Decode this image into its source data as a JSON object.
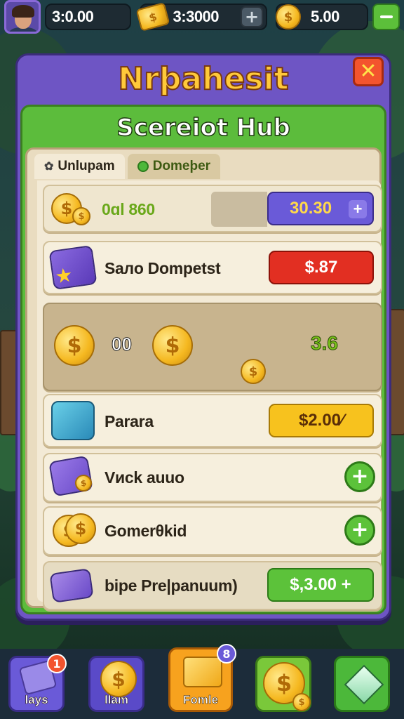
{
  "topbar": {
    "res1": {
      "value": "3:0.00"
    },
    "res2": {
      "value": "3:3000"
    },
    "res3": {
      "value": "5.00"
    }
  },
  "panel": {
    "title": "Nrþahesit",
    "subtitle": "Scereiot Hub",
    "tabs": [
      {
        "label": "Unlupam"
      },
      {
        "label": "Domeþer"
      }
    ]
  },
  "rows": [
    {
      "label": "0ɑl 860",
      "price": "30.30"
    },
    {
      "label": "Saлo Dompetst",
      "price": "$.87"
    },
    {
      "left_value": "00",
      "right_value": "3.6"
    },
    {
      "label": "Parara",
      "price": "$2.00⁄"
    },
    {
      "label": "Vиck auuo"
    },
    {
      "label": "Gomerθkid"
    },
    {
      "label": "bipe Pre|panuum)",
      "price": "$,3.00 +"
    }
  ],
  "nav": [
    {
      "label": "lays",
      "badge": "1"
    },
    {
      "label": "llam"
    },
    {
      "label": "Fomle",
      "badge": "8"
    },
    {
      "label": ""
    },
    {
      "label": ""
    }
  ],
  "colors": {
    "panel_purple": "#6e55c4",
    "inner_green": "#5cbc3c",
    "title_gold": "#ffc93a",
    "price_red": "#e22f22",
    "price_yellow": "#f7c21e",
    "price_green": "#5cc23a"
  }
}
